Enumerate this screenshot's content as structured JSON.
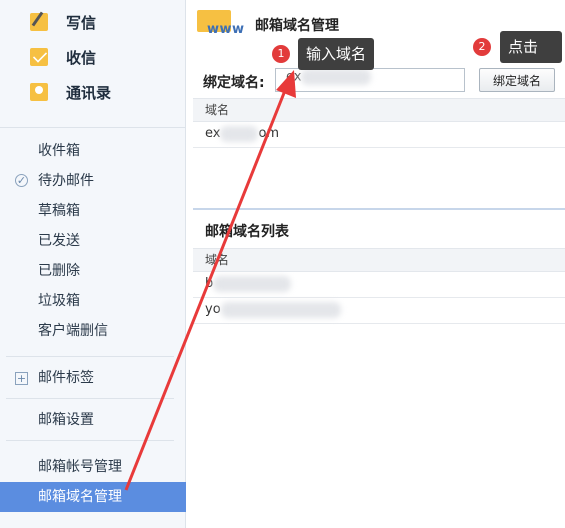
{
  "compose": {
    "write": "写信",
    "inbox": "收信",
    "contacts": "通讯录"
  },
  "folders": {
    "inbox": "收件箱",
    "todo": "待办邮件",
    "drafts": "草稿箱",
    "sent": "已发送",
    "deleted": "已删除",
    "spam": "垃圾箱",
    "client_deleted": "客户端删信",
    "tags": "邮件标签",
    "settings": "邮箱设置",
    "account_mgmt": "邮箱帐号管理",
    "domain_mgmt": "邮箱域名管理"
  },
  "main": {
    "logo_text": "www",
    "title": "邮箱域名管理",
    "bind_label": "绑定域名:",
    "input_value": "ex",
    "bind_button": "绑定域名",
    "table1_header": "域名",
    "table1_rows": [
      "ex",
      "om"
    ],
    "list_title": "邮箱域名列表",
    "table2_header": "域名",
    "table2_rows": [
      "b",
      "yo"
    ]
  },
  "annotations": {
    "step1_num": "1",
    "step1_text": "输入域名",
    "step2_num": "2",
    "step2_text": "点击"
  },
  "colors": {
    "active_row": "#5b8de0",
    "badge": "#e23b3b",
    "arrow": "#e83a3a"
  }
}
